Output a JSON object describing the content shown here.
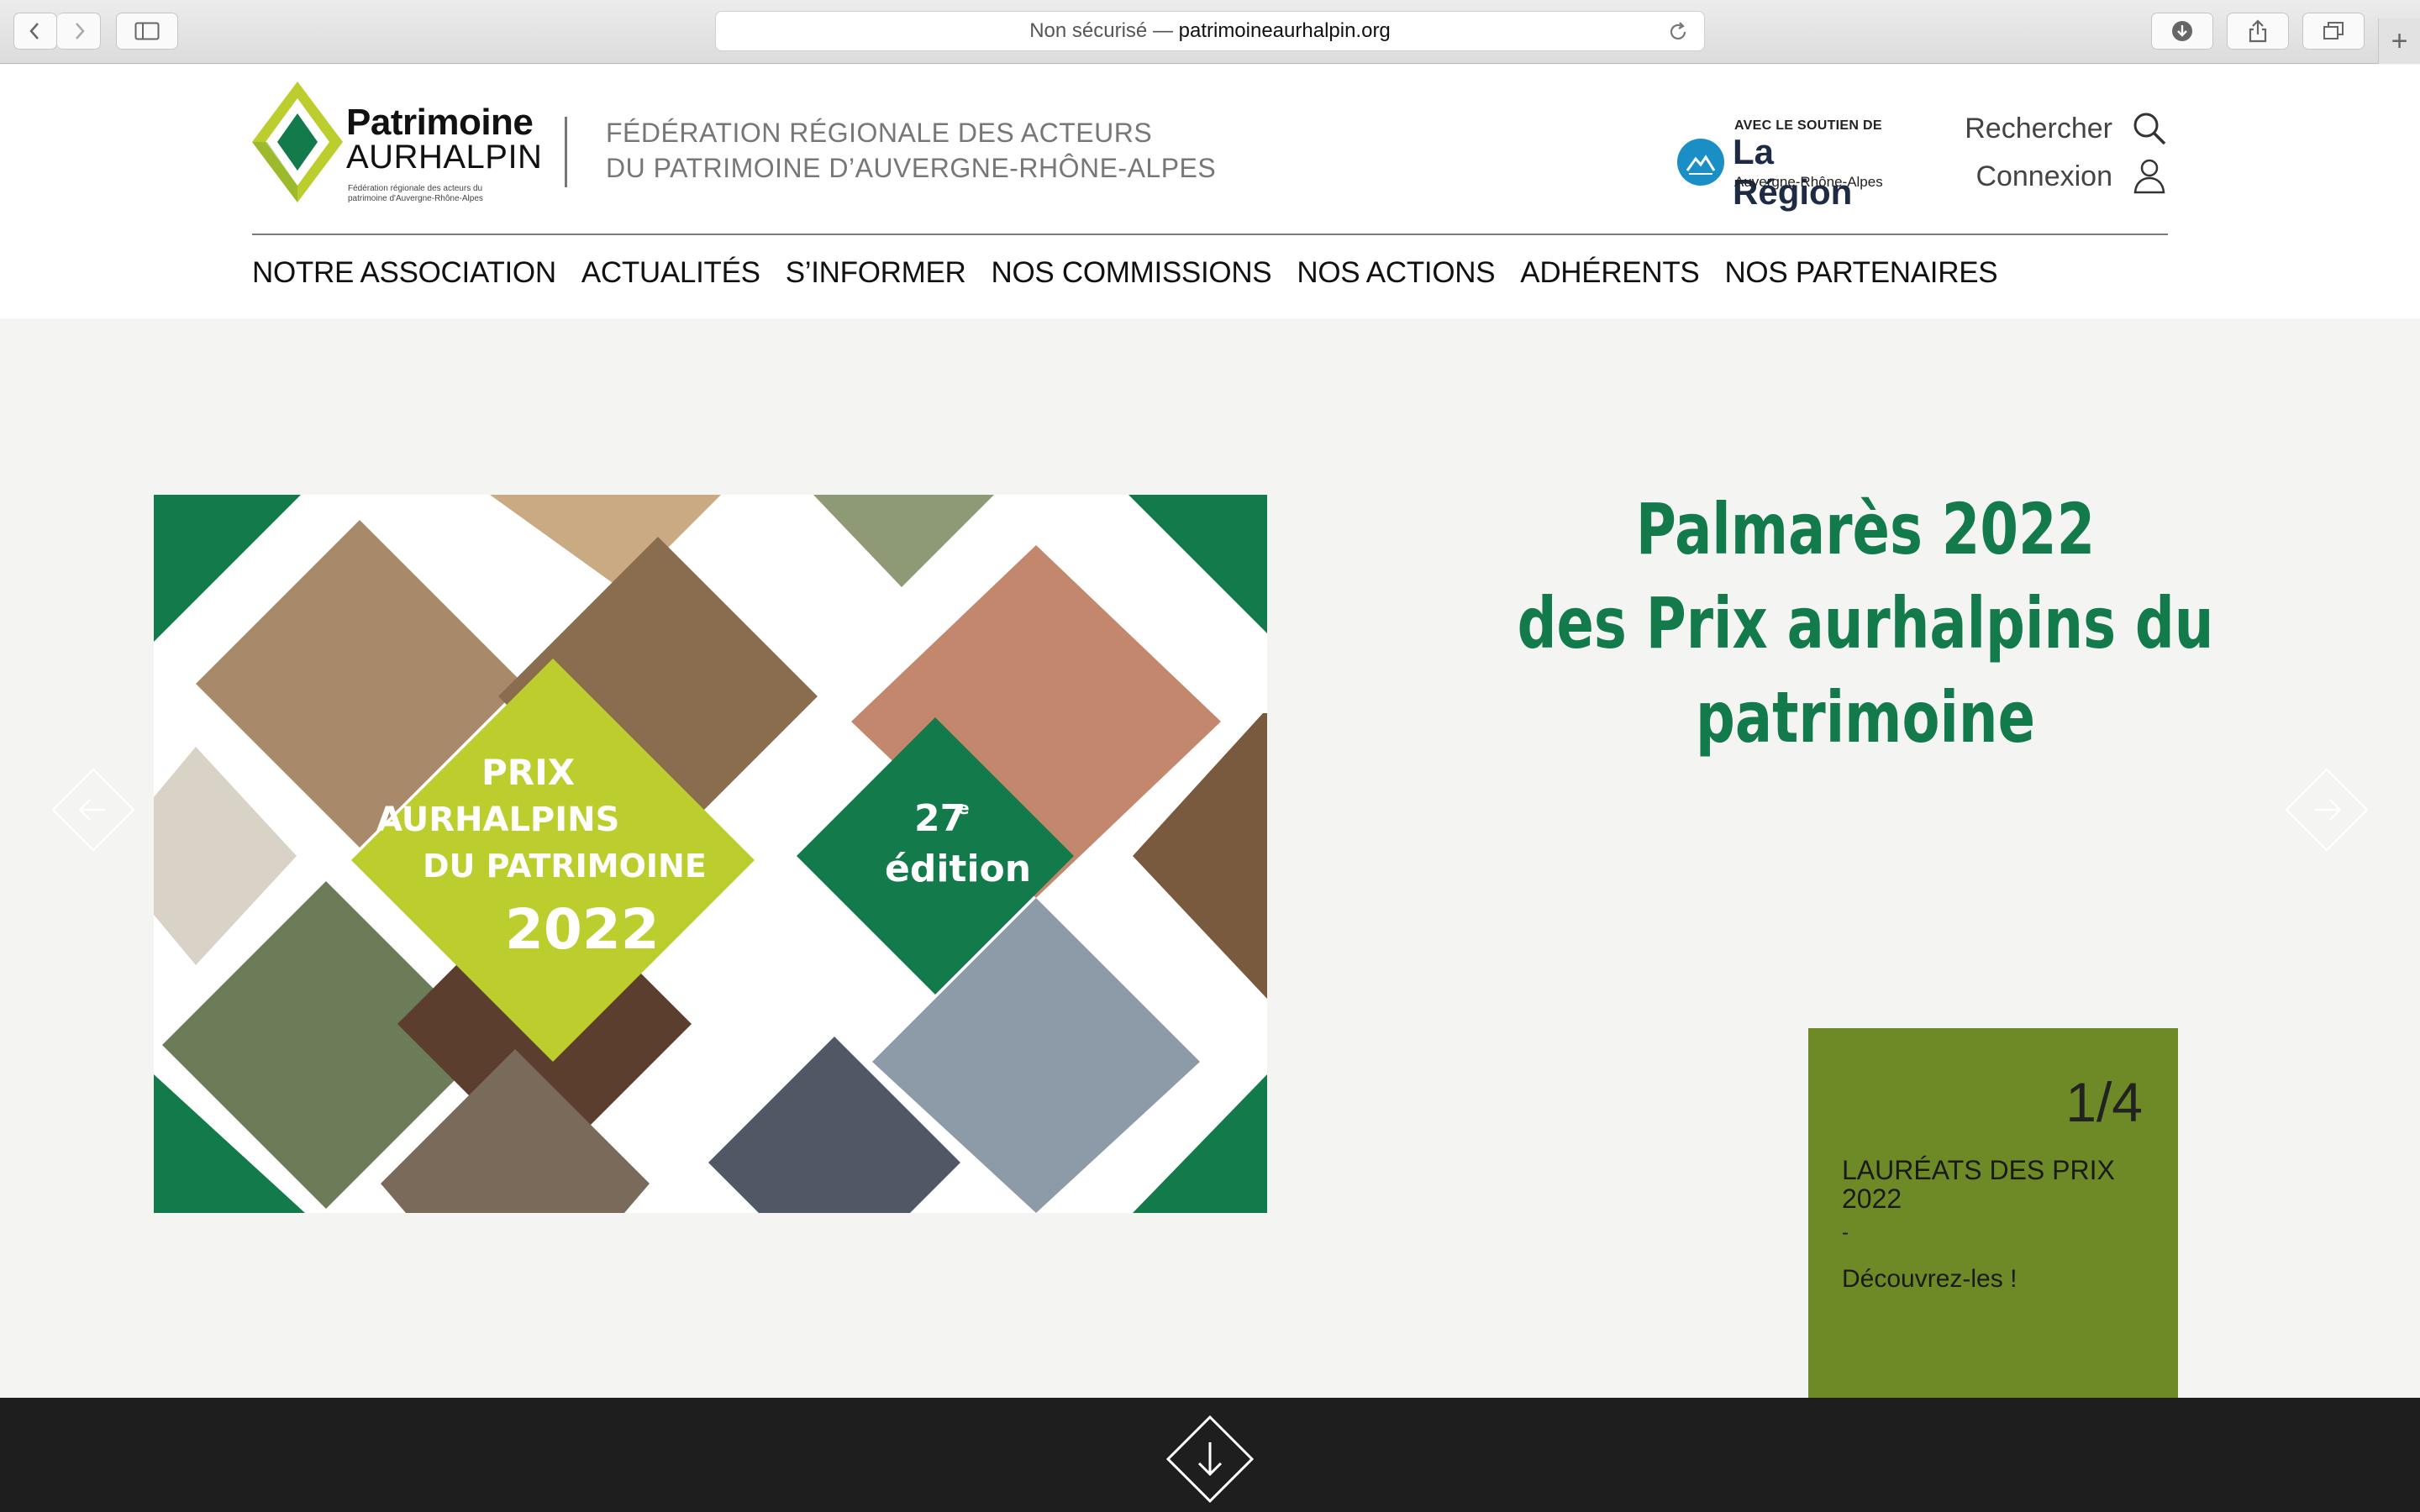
{
  "browser": {
    "url_prefix": "Non sécurisé —",
    "url_host": "patrimoineaurhalpin.org",
    "new_tab": "+"
  },
  "header": {
    "logo": {
      "title": "Patrimoine",
      "subtitle": "AURHALPIN",
      "tagline": "Fédération régionale des acteurs du patrimoine d'Auvergne-Rhône-Alpes"
    },
    "federation_line1": "FÉDÉRATION RÉGIONALE DES ACTEURS",
    "federation_line2": "DU PATRIMOINE D’AUVERGNE-RHÔNE-ALPES",
    "region": {
      "avec": "AVEC LE SOUTIEN DE",
      "name": "La Région",
      "sub": "Auvergne-Rhône-Alpes"
    },
    "search_label": "Rechercher",
    "login_label": "Connexion"
  },
  "nav": [
    "NOTRE ASSOCIATION",
    "ACTUALITÉS",
    "S’INFORMER",
    "NOS COMMISSIONS",
    "NOS ACTIONS",
    "ADHÉRENTS",
    "NOS PARTENAIRES"
  ],
  "hero": {
    "headline_line1": "Palmarès 2022",
    "headline_line2": "des Prix aurhalpins du patrimoine",
    "image_text": {
      "prix": "PRIX",
      "aurhalpins": "AURHALPINS",
      "du_patrimoine": "DU PATRIMOINE",
      "year": "2022",
      "edition_num": "27",
      "edition_sup": "e",
      "edition_word": "édition"
    },
    "card": {
      "counter": "1/4",
      "title": "LAURÉATS DES PRIX 2022",
      "dash": "-",
      "link": "Découvrez-les !"
    }
  },
  "colors": {
    "brand_green": "#127a4b",
    "lime": "#bccd2e",
    "card_olive": "#6e8a27",
    "region_blue": "#1a8fc6",
    "footer": "#1e1e1e"
  }
}
